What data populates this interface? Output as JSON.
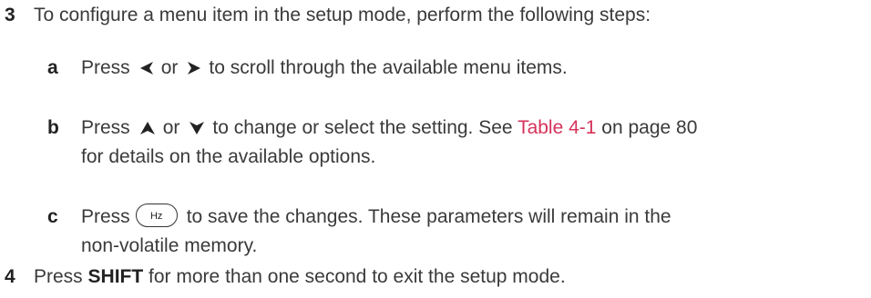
{
  "step3": {
    "num": "3",
    "text": "To configure a menu item in the setup mode, perform the following steps:"
  },
  "step_a": {
    "letter": "a",
    "press": "Press",
    "or": "or",
    "rest": "to scroll through the available menu items.",
    "icon_left": "left-arrow-key-icon",
    "icon_right": "right-arrow-key-icon"
  },
  "step_b": {
    "letter": "b",
    "press": "Press",
    "or": "or",
    "rest": "to change or select the setting. See",
    "link": "Table 4-1",
    "rest2": "on page 80",
    "line2": "for details on the available options.",
    "icon_up": "up-arrow-key-icon",
    "icon_down": "down-arrow-key-icon"
  },
  "step_c": {
    "letter": "c",
    "press": "Press",
    "key_label": "Hz",
    "rest": "to save the changes. These parameters will remain in the",
    "line2": "non-volatile memory."
  },
  "step4": {
    "num": "4",
    "press": "Press",
    "key": "SHIFT",
    "rest": "for more than one second to exit the setup mode."
  },
  "colors": {
    "text": "#3a3a3a",
    "link": "#d6335a"
  }
}
